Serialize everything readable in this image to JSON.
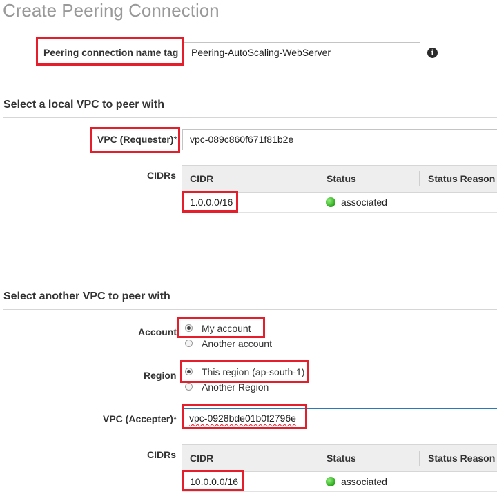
{
  "page": {
    "title": "Create Peering Connection"
  },
  "name_tag": {
    "label": "Peering connection name tag",
    "value": "Peering-AutoScaling-WebServer",
    "info_icon": "info-icon"
  },
  "local": {
    "heading": "Select a local VPC to peer with",
    "vpc_label": "VPC (Requester)",
    "required_mark": "*",
    "vpc_value": "vpc-089c860f671f81b2e",
    "cidrs_label": "CIDRs",
    "table": {
      "columns": [
        "CIDR",
        "Status",
        "Status Reason"
      ],
      "rows": [
        {
          "cidr": "1.0.0.0/16",
          "status": "associated",
          "status_color": "#3cb52a"
        }
      ]
    }
  },
  "remote": {
    "heading": "Select another VPC to peer with",
    "account_label": "Account",
    "account_options": [
      "My account",
      "Another account"
    ],
    "account_selected": "My account",
    "region_label": "Region",
    "region_options": [
      "This region (ap-south-1)",
      "Another Region"
    ],
    "region_selected": "This region (ap-south-1)",
    "vpc_label": "VPC (Accepter)",
    "required_mark": "*",
    "vpc_value": "vpc-0928bde01b0f2796e",
    "cidrs_label": "CIDRs",
    "table": {
      "columns": [
        "CIDR",
        "Status",
        "Status Reason"
      ],
      "rows": [
        {
          "cidr": "10.0.0.0/16",
          "status": "associated",
          "status_color": "#3cb52a"
        }
      ]
    }
  },
  "colors": {
    "highlight_box": "#e41e2b",
    "accent_border": "#2a7ab8"
  }
}
